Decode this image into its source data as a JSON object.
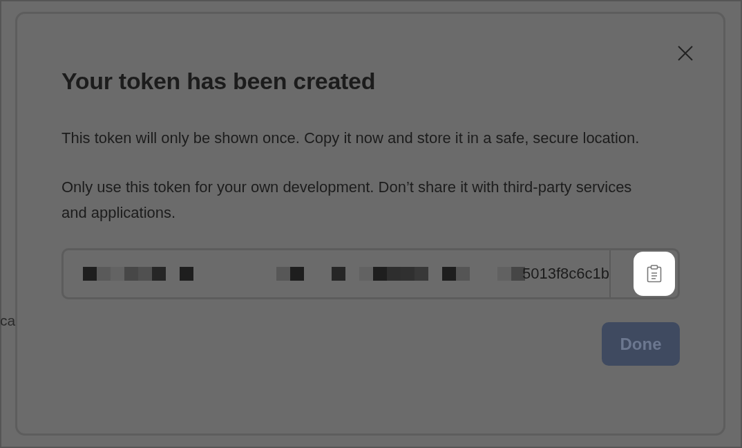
{
  "background": {
    "text": "ca"
  },
  "dialog": {
    "title": "Your token has been created",
    "paragraphs": [
      "This token will only be shown once. Copy it now and store it in a safe, secure location.",
      "Only use this token for your own development. Don’t share it with third-party services and applications."
    ],
    "token_field": {
      "value": "5013f8c6c1b"
    },
    "done_button": {
      "label": "Done",
      "disabled": true
    }
  }
}
